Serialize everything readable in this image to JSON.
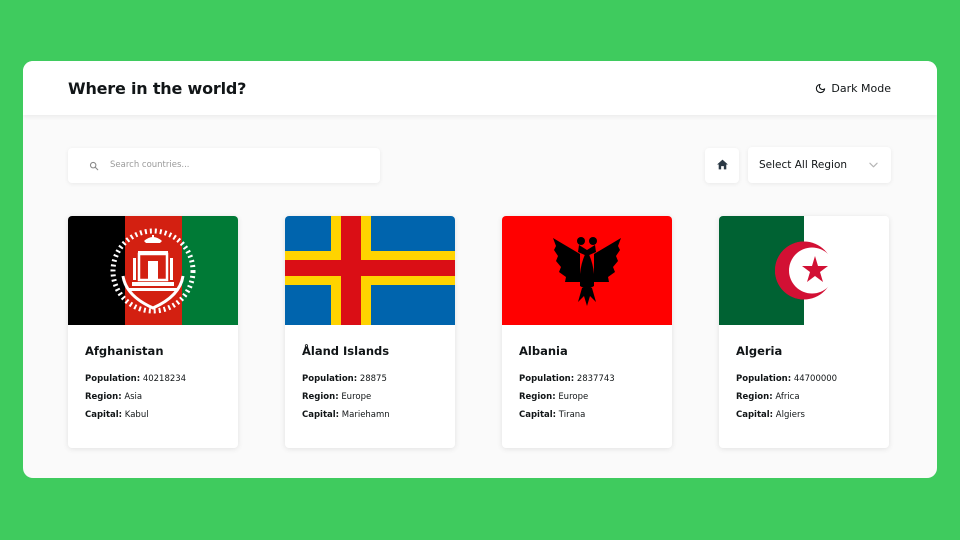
{
  "header": {
    "title": "Where in the world?",
    "theme_toggle_label": "Dark Mode"
  },
  "search": {
    "placeholder": "Search countries...",
    "value": ""
  },
  "filter": {
    "selected": "Select All Region"
  },
  "labels": {
    "population": "Population:",
    "region": "Region:",
    "capital": "Capital:"
  },
  "countries": [
    {
      "name": "Afghanistan",
      "population": "40218234",
      "region": "Asia",
      "capital": "Kabul"
    },
    {
      "name": "Åland Islands",
      "population": "28875",
      "region": "Europe",
      "capital": "Mariehamn"
    },
    {
      "name": "Albania",
      "population": "2837743",
      "region": "Europe",
      "capital": "Tirana"
    },
    {
      "name": "Algeria",
      "population": "44700000",
      "region": "Africa",
      "capital": "Algiers"
    }
  ],
  "icons": {
    "theme": "moon-icon",
    "search": "search-icon",
    "home": "home-icon",
    "dropdown": "chevron-down-icon"
  },
  "colors": {
    "background": "#3fcb5e",
    "surface": "#fafafa",
    "card": "#ffffff",
    "text": "#111517"
  }
}
